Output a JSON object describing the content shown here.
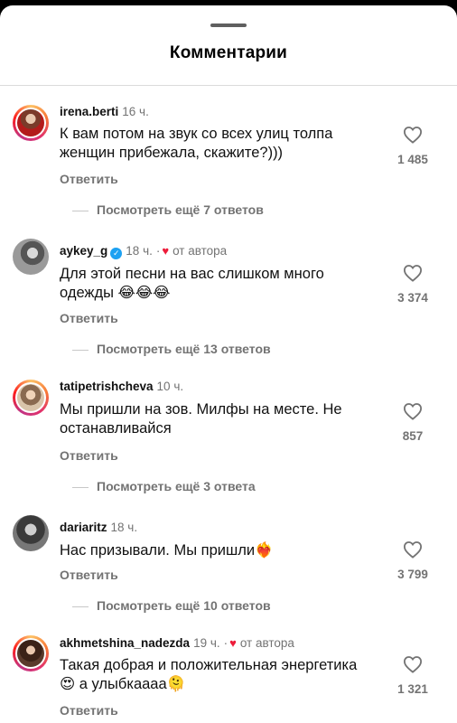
{
  "header": {
    "title": "Комментарии"
  },
  "reply_label": "Ответить",
  "comments": [
    {
      "username": "irena.berti",
      "time": "16 ч.",
      "text_line1": "К вам потом на звук со всех улиц толпа",
      "text_line2": "женщин прибежала, скажите?)))",
      "likes": "1 485",
      "more_replies": "Посмотреть ещё 7 ответов"
    },
    {
      "username": "aykey_g",
      "verified": true,
      "time": "18 ч.",
      "author_tag": "от автора",
      "text_line1": "Для этой песни на вас слишком много",
      "text_line2": "одежды 😂😂😂",
      "likes": "3 374",
      "more_replies": "Посмотреть ещё 13 ответов"
    },
    {
      "username": "tatipetrishcheva",
      "time": "10 ч.",
      "text_line1": "Мы пришли на зов. Милфы на месте. Не",
      "text_line2": "останавливайся",
      "likes": "857",
      "more_replies": "Посмотреть ещё 3 ответа"
    },
    {
      "username": "dariaritz",
      "time": "18 ч.",
      "text_line1": "Нас призывали. Мы пришли❤️‍🔥",
      "likes": "3 799",
      "more_replies": "Посмотреть ещё 10 ответов"
    },
    {
      "username": "akhmetshina_nadezda",
      "time": "19 ч.",
      "author_tag": "от автора",
      "text_line1": "Такая добрая и положительная энергетика",
      "text_line2": "😍 а улыбкаааа🫠",
      "likes": "1 321"
    }
  ],
  "colors": {
    "background": "#ffffff",
    "secondary_text": "#737373",
    "author_heart": "#ed1c3a",
    "verified": "#1da1f2"
  }
}
